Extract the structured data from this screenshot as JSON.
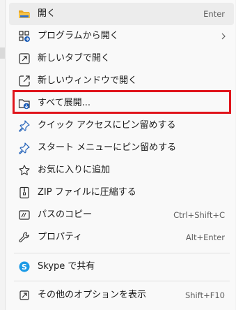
{
  "menu": {
    "items": [
      {
        "label": "開く",
        "shortcut": "Enter",
        "icon": "folder-open-icon"
      },
      {
        "label": "プログラムから開く",
        "shortcut": "",
        "icon": "open-with-icon",
        "submenu": true
      },
      {
        "label": "新しいタブで開く",
        "shortcut": "",
        "icon": "new-tab-icon"
      },
      {
        "label": "新しいウィンドウで開く",
        "shortcut": "",
        "icon": "new-window-icon"
      },
      {
        "label": "すべて展開...",
        "shortcut": "",
        "icon": "extract-all-icon"
      },
      {
        "label": "クイック アクセスにピン留めする",
        "shortcut": "",
        "icon": "pin-icon"
      },
      {
        "label": "スタート メニューにピン留めする",
        "shortcut": "",
        "icon": "pin-start-icon"
      },
      {
        "label": "お気に入りに追加",
        "shortcut": "",
        "icon": "star-icon"
      },
      {
        "label": "ZIP ファイルに圧縮する",
        "shortcut": "",
        "icon": "zip-icon"
      },
      {
        "label": "パスのコピー",
        "shortcut": "Ctrl+Shift+C",
        "icon": "copy-path-icon"
      },
      {
        "label": "プロパティ",
        "shortcut": "Alt+Enter",
        "icon": "wrench-icon"
      },
      {
        "label": "Skype で共有",
        "shortcut": "",
        "icon": "skype-icon"
      },
      {
        "label": "その他のオプションを表示",
        "shortcut": "Shift+F10",
        "icon": "more-options-icon"
      }
    ]
  },
  "colors": {
    "highlight_border": "#e0141b",
    "icon_blue": "#1f5fb8",
    "folder_yellow": "#f0b63a",
    "skype_blue": "#1b9ae6"
  }
}
